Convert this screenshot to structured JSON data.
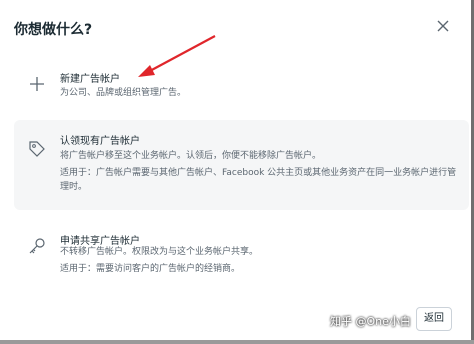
{
  "dialog": {
    "title": "你想做什么?",
    "close_icon": "close-icon",
    "options": [
      {
        "icon": "plus-icon",
        "title": "新建广告帐户",
        "description": "为公司、品牌或组织管理广告。"
      },
      {
        "icon": "tag-icon",
        "title": "认领现有广告帐户",
        "description": "将广告帐户移至这个业务帐户。认领后，你便不能移除广告帐户。",
        "note": "适用于：广告帐户需要与其他广告帐户、Facebook 公共主页或其他业务资产在同一业务帐户进行管理时。"
      },
      {
        "icon": "key-icon",
        "title": "申请共享广告帐户",
        "description": "不转移广告帐户。权限改为与这个业务帐户共享。",
        "note": "适用于：需要访问客户的广告帐户的经销商。"
      }
    ],
    "back_label": "返回"
  },
  "watermark": "知乎 @One小白",
  "colors": {
    "annotation_arrow": "#e0262b",
    "selected_bg": "#f5f6f7"
  }
}
